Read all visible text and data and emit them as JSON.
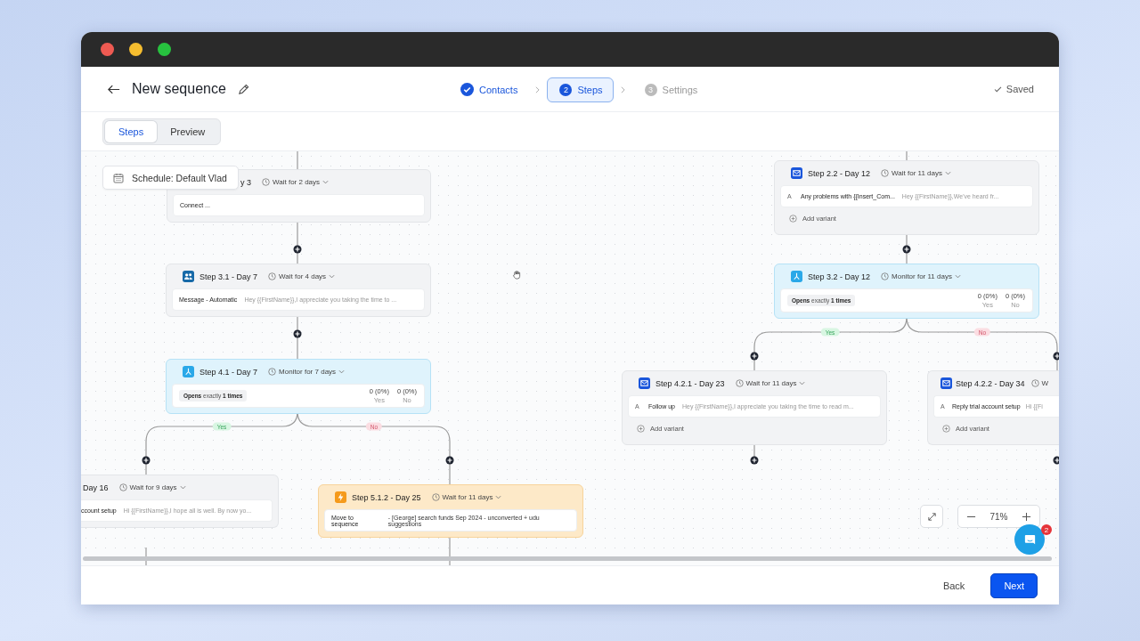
{
  "window": {
    "traffic_lights": [
      {
        "color": "#ee5a52"
      },
      {
        "color": "#f5bd2f"
      },
      {
        "color": "#27c23f"
      }
    ]
  },
  "header": {
    "title": "New sequence",
    "saved": "Saved",
    "stepper": [
      {
        "label": "Contacts",
        "completed": true,
        "selected": false
      },
      {
        "number": "2",
        "label": "Steps",
        "completed": false,
        "selected": true
      },
      {
        "number": "3",
        "label": "Settings",
        "completed": false,
        "selected": false
      }
    ]
  },
  "view_tabs": [
    {
      "label": "Steps",
      "selected": true
    },
    {
      "label": "Preview",
      "selected": false
    }
  ],
  "canvas": {
    "schedule": "Schedule: Default Vlad",
    "nodes": [
      {
        "kind": "none",
        "title": "y 3",
        "delay": "Wait for 2 days",
        "body": "Connect ..."
      },
      {
        "kind": "linkedin",
        "title": "Step 3.1 - Day 7",
        "delay": "Wait for 4 days",
        "message": {
          "label": "Message - Automatic",
          "preview": "Hey {{FirstName}},I appreciate you taking the time to ..."
        }
      },
      {
        "kind": "monitor",
        "title": "Step 4.1 - Day 7",
        "delay": "Monitor for 7 days",
        "condition": "**Opens** exactly **1 times**",
        "stats": [
          {
            "value": "0 (0%)",
            "label": "Yes"
          },
          {
            "value": "0 (0%)",
            "label": "No"
          }
        ],
        "branches": [
          {
            "kind": "yes",
            "label": "Yes"
          },
          {
            "kind": "no",
            "label": "No"
          }
        ]
      },
      {
        "kind": "none",
        "title": "Day 16",
        "delay": "Wait for 9 days",
        "message": {
          "label": "ccount setup",
          "preview": "Hi {{FirstName}},I hope all is well. By now yo..."
        }
      },
      {
        "kind": "action",
        "title": "Step 5.1.2 - Day 25",
        "delay": "Wait for 11 days",
        "message": {
          "label": "Move to sequence",
          "preview": "- [George] search funds Sep 2024 - unconverted + udu suggestions"
        }
      },
      {
        "kind": "email",
        "title": "Step 2.2 - Day 12",
        "delay": "Wait for 11 days",
        "variants": [
          {
            "letter": "A",
            "subject": "Any problems with {{Insert_Com...",
            "preview": "Hey {{FirstName}},We've heard fr..."
          }
        ],
        "add_variant": "Add variant"
      },
      {
        "kind": "monitor",
        "title": "Step 3.2 - Day 12",
        "delay": "Monitor for 11 days",
        "condition": "**Opens** exactly **1 times**",
        "stats": [
          {
            "value": "0 (0%)",
            "label": "Yes"
          },
          {
            "value": "0 (0%)",
            "label": "No"
          }
        ],
        "branches": [
          {
            "kind": "yes",
            "label": "Yes"
          },
          {
            "kind": "no",
            "label": "No"
          }
        ]
      },
      {
        "kind": "email",
        "title": "Step 4.2.1 - Day 23",
        "delay": "Wait for 11 days",
        "variants": [
          {
            "letter": "A",
            "subject": "Follow up",
            "preview": "Hey {{FirstName}},I appreciate you taking the time to read m..."
          }
        ],
        "add_variant": "Add variant"
      },
      {
        "kind": "email",
        "title": "Step 4.2.2 - Day 34",
        "delay": "W",
        "variants": [
          {
            "letter": "A",
            "subject": "Reply trial account setup",
            "preview": "Hi {{Fi"
          }
        ],
        "add_variant": "Add variant"
      }
    ],
    "zoom": "71%"
  },
  "chat": {
    "badge": "2"
  },
  "footer": {
    "buttons": [
      {
        "kind": "secondary",
        "label": "Back"
      },
      {
        "kind": "primary",
        "label": "Next"
      }
    ]
  }
}
